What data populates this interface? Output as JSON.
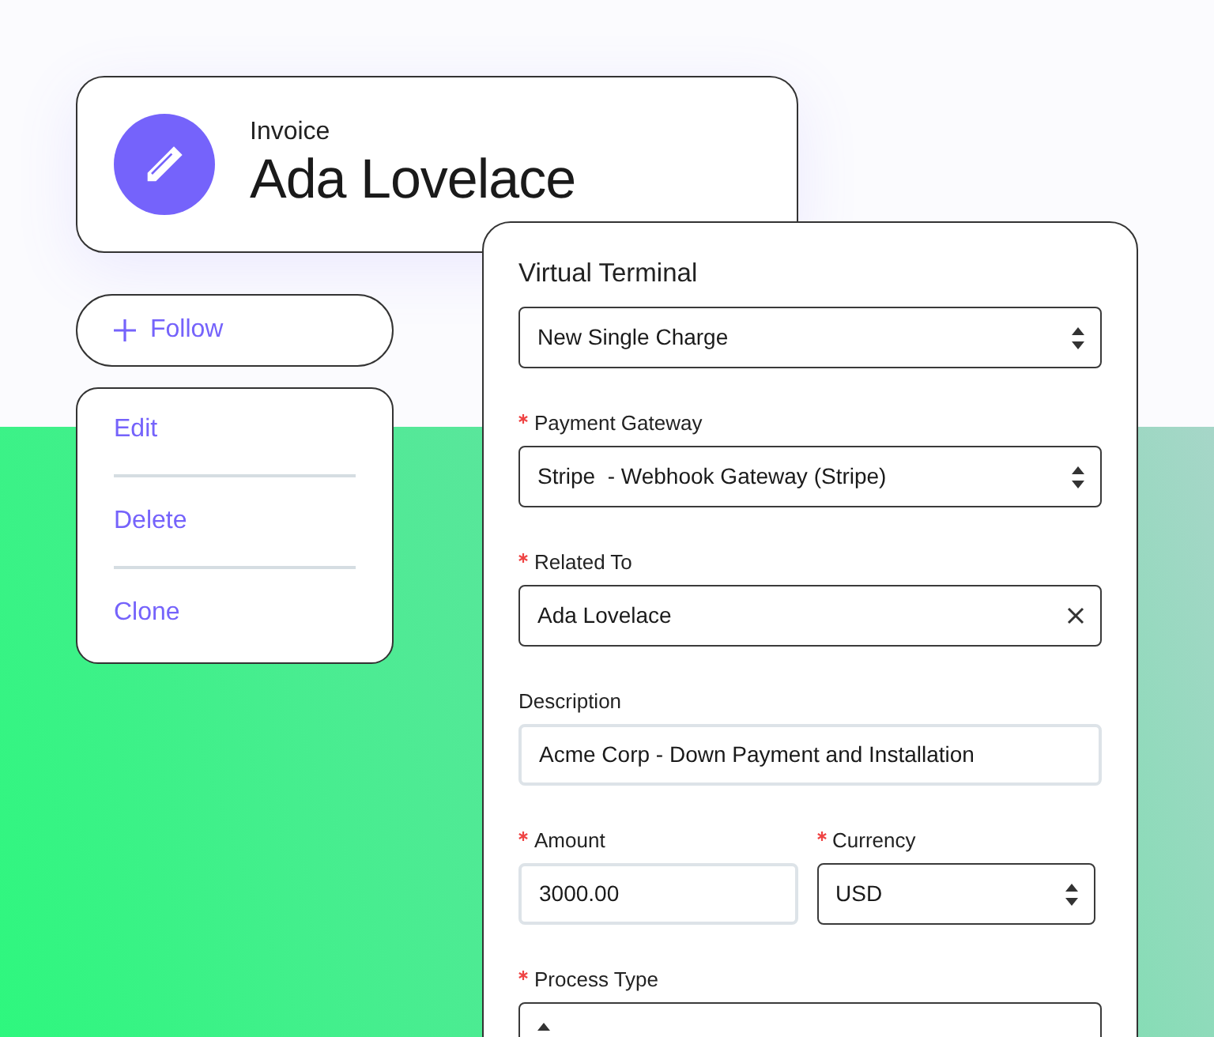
{
  "record_card": {
    "subtitle": "Invoice",
    "title": "Ada Lovelace"
  },
  "follow_button": {
    "label": "Follow"
  },
  "actions_menu": [
    {
      "label": "Edit"
    },
    {
      "label": "Delete"
    },
    {
      "label": "Clone"
    }
  ],
  "terminal": {
    "title": "Virtual Terminal",
    "rows": [
      [
        {
          "kind": "select",
          "value": "New Single Charge"
        }
      ],
      [
        {
          "kind": "select",
          "label": "Payment Gateway",
          "required": true,
          "value": "Stripe  - Webhook Gateway (Stripe)"
        }
      ],
      [
        {
          "kind": "clearable",
          "label": "Related To",
          "required": true,
          "value": "Ada Lovelace"
        }
      ],
      [
        {
          "kind": "text",
          "label": "Description",
          "required": false,
          "value": "Acme Corp - Down Payment and Installation"
        }
      ],
      [
        {
          "kind": "text",
          "label": "Amount",
          "required": true,
          "value": "3000.00"
        },
        {
          "kind": "select",
          "label": "Currency",
          "required": true,
          "value": "USD"
        }
      ],
      [
        {
          "kind": "select",
          "label": "Process Type",
          "required": true
        }
      ]
    ]
  }
}
